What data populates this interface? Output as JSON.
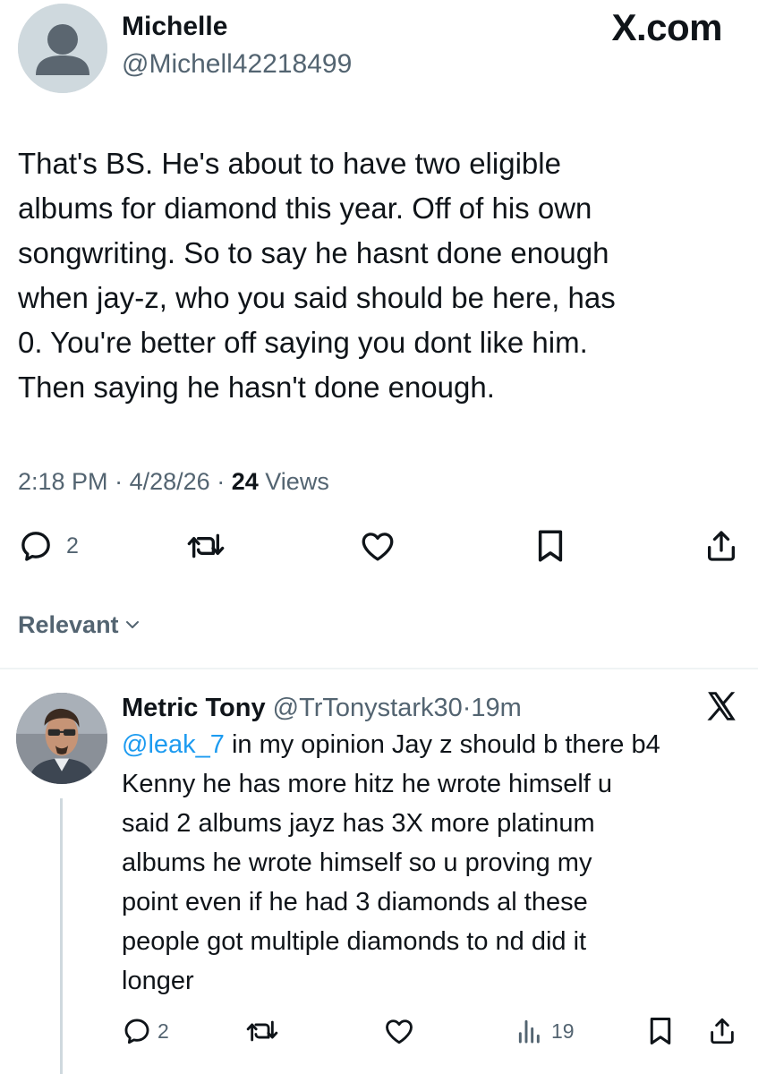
{
  "main_tweet": {
    "author_name": "Michelle",
    "author_handle": "@Michell42218499",
    "source_badge": "X.com",
    "body_lines": [
      "That's BS. He's about to have two eligible",
      "albums for diamond this year. Off of his own",
      "songwriting. So to say he hasnt done enough",
      "when jay-z, who you said should be here, has",
      "0. You're better off saying you dont like him.",
      "Then saying he hasn't done enough."
    ],
    "time": "2:18 PM",
    "date": "4/28/26",
    "separator": "·",
    "views_count": "24",
    "views_label": "Views",
    "reply_count": "2",
    "icons": {
      "reply": "reply-icon",
      "retweet": "retweet-icon",
      "like": "like-icon",
      "bookmark": "bookmark-icon",
      "share": "share-icon"
    }
  },
  "sort": {
    "label": "Relevant",
    "icon": "chevron-down-icon"
  },
  "reply": {
    "author_name": "Metric Tony",
    "author_handle": "@TrTonystark30",
    "separator": "·",
    "time": "19m",
    "mention": "@leak_7",
    "body_first_rest": " in my opinion Jay z should b there b4",
    "body_lines": [
      "Kenny he has more hitz he wrote himself u",
      "said 2 albums jayz has 3X more platinum",
      "albums he wrote himself so u proving my",
      "point even if he had 3 diamonds al these",
      "people got multiple diamonds to nd did it",
      "longer"
    ],
    "reply_count": "2",
    "views_count": "19",
    "icons": {
      "platform": "x-logo-icon",
      "reply": "reply-icon",
      "retweet": "retweet-icon",
      "like": "like-icon",
      "views": "views-icon",
      "bookmark": "bookmark-icon",
      "share": "share-icon"
    }
  },
  "colors": {
    "text_primary": "#0f1419",
    "text_secondary": "#536471",
    "link": "#1d9bf0",
    "divider": "#eff3f4",
    "thread_line": "#cfd9de"
  }
}
